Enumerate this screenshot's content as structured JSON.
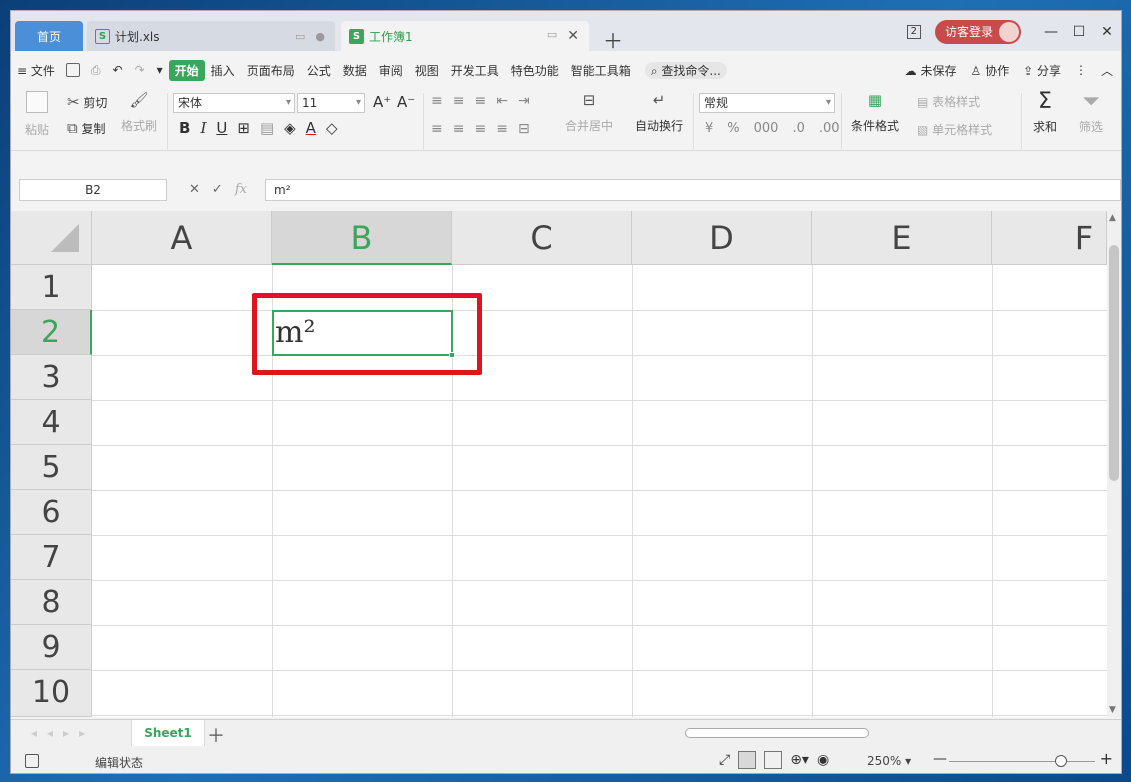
{
  "tabs": {
    "home": "首页",
    "file": "计划.xls",
    "workbook": "工作簿1",
    "badge": "2",
    "login": "访客登录"
  },
  "menu": {
    "file": "文件",
    "items": [
      "开始",
      "插入",
      "页面布局",
      "公式",
      "数据",
      "审阅",
      "视图",
      "开发工具",
      "特色功能",
      "智能工具箱"
    ],
    "search": "查找命令...",
    "unsaved": "未保存",
    "collab": "协作",
    "share": "分享"
  },
  "ribbon": {
    "paste": "粘贴",
    "cut": "剪切",
    "copy": "复制",
    "format_painter": "格式刷",
    "font_name": "宋体",
    "font_size": "11",
    "merge_center": "合并居中",
    "wrap_text": "自动换行",
    "number_format": "常规",
    "conditional_format": "条件格式",
    "table_style": "表格样式",
    "cell_style": "单元格样式",
    "sum": "求和",
    "filter": "筛选"
  },
  "formula_bar": {
    "name_box": "B2",
    "fx": "fx",
    "content": "m²"
  },
  "grid": {
    "columns": [
      "A",
      "B",
      "C",
      "D",
      "E",
      "F"
    ],
    "rows": [
      "1",
      "2",
      "3",
      "4",
      "5",
      "6",
      "7",
      "8",
      "9",
      "10"
    ],
    "active_cell": "B2",
    "active_cell_text": "m²"
  },
  "sheets": {
    "tabs": [
      "Sheet1"
    ]
  },
  "status": {
    "mode": "编辑状态",
    "zoom": "250%"
  },
  "colors": {
    "accent": "#3aa55c",
    "highlight": "#e0141e"
  }
}
